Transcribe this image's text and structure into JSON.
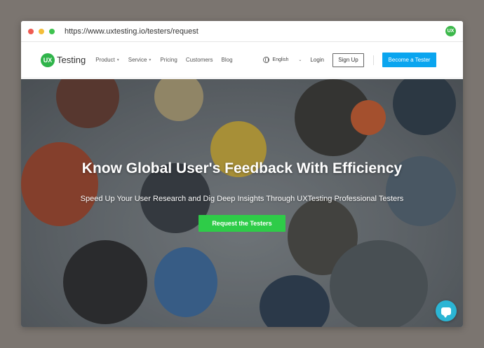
{
  "browser": {
    "url": "https://www.uxtesting.io/testers/request",
    "favicon_text": "UX"
  },
  "nav": {
    "logo_badge": "UX",
    "logo_text": "Testing",
    "menu": [
      {
        "label": "Product",
        "has_caret": true
      },
      {
        "label": "Service",
        "has_caret": true
      },
      {
        "label": "Pricing",
        "has_caret": false
      },
      {
        "label": "Customers",
        "has_caret": false
      },
      {
        "label": "Blog",
        "has_caret": false
      }
    ],
    "language": "English",
    "login": "Login",
    "signup": "Sign Up",
    "become_tester": "Become a Tester"
  },
  "hero": {
    "title": "Know Global User's Feedback With Efficiency",
    "subtitle": "Speed Up Your User Research and Dig Deep Insights Through UXTesting Professional Testers",
    "cta": "Request the Testers"
  },
  "colors": {
    "brand_green": "#2fb44a",
    "cta_green": "#2ecc48",
    "accent_blue": "#0aa5ef",
    "chat_teal": "#2bb5d4"
  },
  "icons": {
    "globe": "globe-icon",
    "chat": "chat-icon"
  }
}
